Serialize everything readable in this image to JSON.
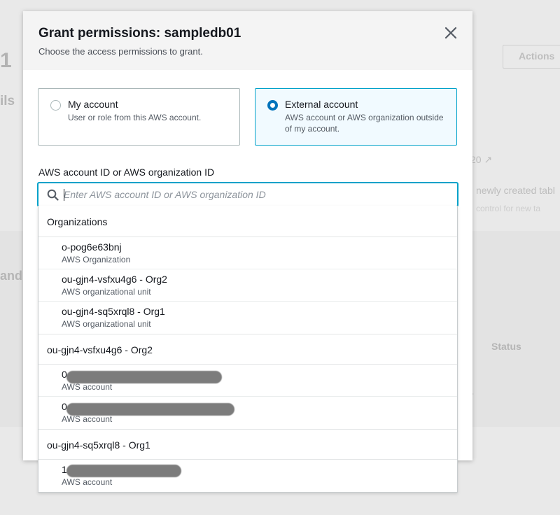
{
  "background": {
    "big_number": "1",
    "details_fragment": "ils",
    "actions_label": "Actions",
    "external_link_fragment": "20",
    "newly_created_fragment": "newly created tabl",
    "control_fragment": "control for new ta",
    "and_fragment": "and",
    "status_header": "Status",
    "dash": "-"
  },
  "modal": {
    "title": "Grant permissions: sampledb01",
    "subtitle": "Choose the access permissions to grant.",
    "close_icon": "close-icon",
    "tiles": [
      {
        "title": "My account",
        "description": "User or role from this AWS account.",
        "selected": false
      },
      {
        "title": "External account",
        "description": "AWS account or AWS organization outside of my account.",
        "selected": true
      }
    ],
    "field_label": "AWS account ID or AWS organization ID",
    "search": {
      "placeholder": "Enter AWS account ID or AWS organization ID",
      "value": ""
    }
  },
  "dropdown": {
    "groups": [
      {
        "header": "Organizations",
        "options": [
          {
            "label": "o-pog6e63bnj",
            "desc": "AWS Organization"
          },
          {
            "label": "ou-gjn4-vsfxu4g6 - Org2",
            "desc": "AWS organizational unit"
          },
          {
            "label": "ou-gjn4-sq5xrql8 - Org1",
            "desc": "AWS organizational unit"
          }
        ]
      },
      {
        "header": "ou-gjn4-vsfxu4g6 - Org2",
        "options": [
          {
            "label": "0",
            "desc": "AWS account"
          },
          {
            "label": "0",
            "desc": "AWS account"
          }
        ]
      },
      {
        "header": "ou-gjn4-sq5xrql8 - Org1",
        "options": [
          {
            "label": "1",
            "desc": "AWS account"
          }
        ]
      }
    ]
  },
  "colors": {
    "selected_border": "#00a1c9",
    "selected_bg": "#f1faff",
    "radio_selected": "#0073bb",
    "redaction": "#7c7c7c"
  }
}
